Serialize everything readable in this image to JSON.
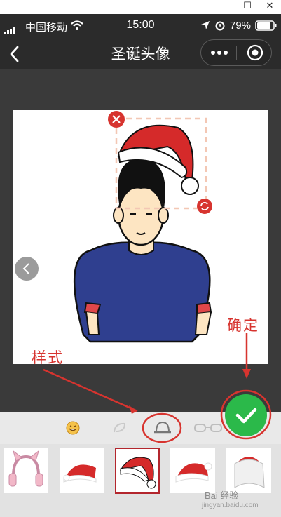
{
  "window": {
    "minimize": "—",
    "maximize": "☐",
    "close": "✕"
  },
  "status": {
    "carrier": "中国移动",
    "time": "15:00",
    "battery": "79%"
  },
  "nav": {
    "title": "圣诞头像"
  },
  "annotations": {
    "style_label": "样式",
    "confirm_label": "确定"
  },
  "toolbar": {
    "tabs": [
      "emoji-icon",
      "leaf-icon",
      "hat-icon",
      "glasses-icon"
    ],
    "selected": 2
  },
  "thumbnails": [
    "cat-ear-headphones",
    "santa-hat-1",
    "santa-hat-2",
    "santa-hat-3",
    "santa-hat-4"
  ],
  "watermark": {
    "line1": "Bai 经验",
    "line2": "jingyan.baidu.com"
  },
  "colors": {
    "accent_red": "#d7342f",
    "confirm_green": "#2bb94a",
    "shirt_blue": "#2f3f8f"
  }
}
